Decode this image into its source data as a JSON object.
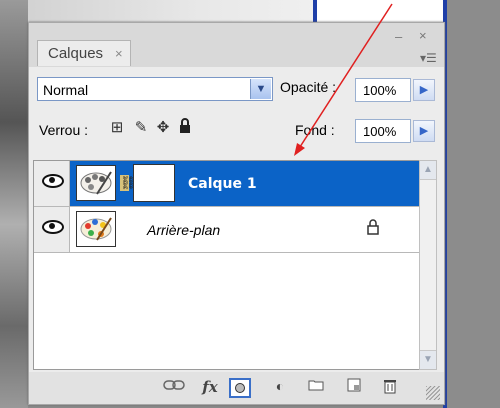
{
  "panel": {
    "tab_label": "Calques",
    "tab_close": "×",
    "window_min": "–",
    "window_close": "×",
    "menu_glyph": "▾☰"
  },
  "controls": {
    "blend_mode": "Normal",
    "opacity_label": "Opacité :",
    "opacity_value": "100%",
    "lock_label": "Verrou :",
    "fill_label": "Fond :",
    "fill_value": "100%"
  },
  "layers": [
    {
      "name": "Calque 1",
      "selected": true,
      "has_mask": true,
      "visible": true
    },
    {
      "name": "Arrière-plan",
      "selected": false,
      "locked": true,
      "visible": true
    }
  ],
  "icons": {
    "lock_transparent": "⊞",
    "lock_paint": "✎",
    "lock_move": "✥",
    "lock_all": "🔒",
    "link": "⛓",
    "fx": "fx",
    "adjustment": "◐",
    "folder": "▭",
    "new_layer": "◳",
    "trash": "🗑"
  },
  "colors": {
    "selection": "#0b63c7",
    "annotation_arrow": "#e02020"
  }
}
